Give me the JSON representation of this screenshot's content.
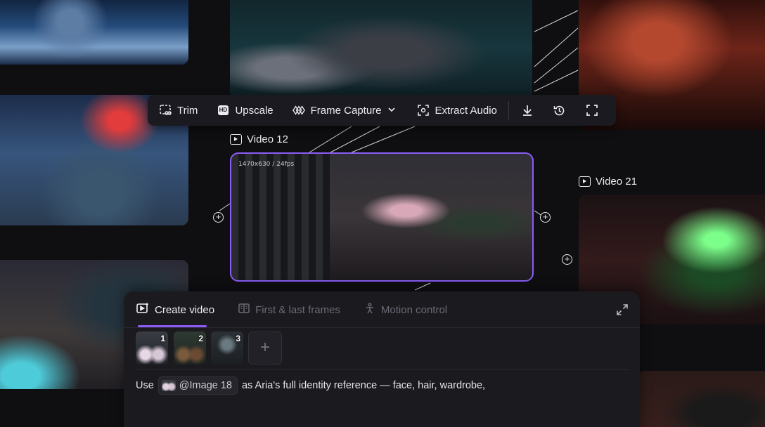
{
  "toolbar": {
    "trim": "Trim",
    "upscale": "Upscale",
    "upscale_badge": "HD",
    "frame_capture": "Frame Capture",
    "extract_audio": "Extract Audio"
  },
  "canvas": {
    "video12_label": "Video 12",
    "video12_meta": "1470x630 / 24fps",
    "video21_label": "Video 21"
  },
  "panel": {
    "tabs": [
      "Create video",
      "First & last frames",
      "Motion control"
    ],
    "thumbs": [
      "1",
      "2",
      "3"
    ],
    "add_label": "+",
    "prompt_prefix": "Use",
    "chip_label": "@Image 18",
    "prompt_rest": "as Aria's full identity reference — face, hair, wardrobe,"
  },
  "colors": {
    "accent": "#8b5cf6",
    "background": "#0f0e11",
    "toolbar_bg": "#1b1a20",
    "panel_bg": "#1b1a1f"
  }
}
